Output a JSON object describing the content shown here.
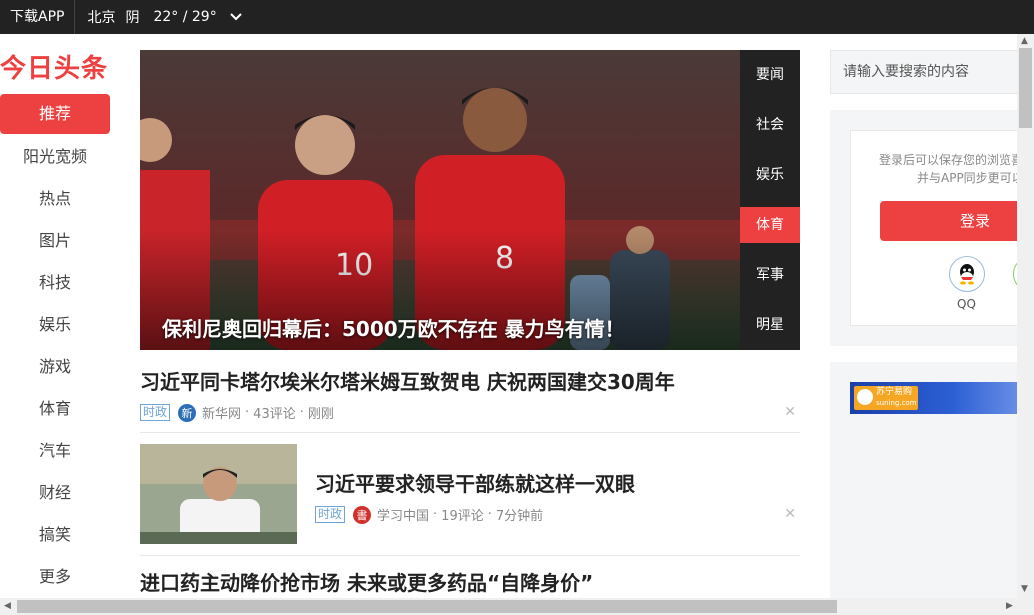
{
  "topbar": {
    "download": "下载APP",
    "city": "北京",
    "weather": "阴",
    "temp": "22° / 29°"
  },
  "logo": "今日头条",
  "nav": {
    "items": [
      "推荐",
      "阳光宽频",
      "热点",
      "图片",
      "科技",
      "娱乐",
      "游戏",
      "体育",
      "汽车",
      "财经",
      "搞笑",
      "更多"
    ]
  },
  "hero": {
    "caption": "保利尼奥回归幕后：5000万欧不存在 暴力鸟有情！",
    "tabs": [
      "要闻",
      "社会",
      "娱乐",
      "体育",
      "军事",
      "明星"
    ],
    "active_tab": "体育"
  },
  "feed": [
    {
      "title": "习近平同卡塔尔埃米尔塔米姆互致贺电 庆祝两国建交30周年",
      "tag": "时政",
      "source": "新华网",
      "comments": "43评论",
      "time": "刚刚"
    },
    {
      "title": "习近平要求领导干部练就这样一双眼",
      "tag": "时政",
      "source": "学习中国",
      "comments": "19评论",
      "time": "7分钟前"
    },
    {
      "title": "进口药主动降价抢市场 未来或更多药品“自降身价”"
    }
  ],
  "meta_sep": "·",
  "close_glyph": "✕",
  "search": {
    "placeholder": "请输入要搜索的内容"
  },
  "login": {
    "text_line1": "登录后可以保存您的浏览喜",
    "text_line2": "并与APP同步更可以",
    "button": "登录",
    "qq_label": "QQ"
  },
  "ad": {
    "brand": "苏宁易购",
    "domain": "suning.com"
  },
  "colors": {
    "accent": "#ed4040",
    "topbar": "#222222",
    "tag": "#6fa5d8"
  }
}
